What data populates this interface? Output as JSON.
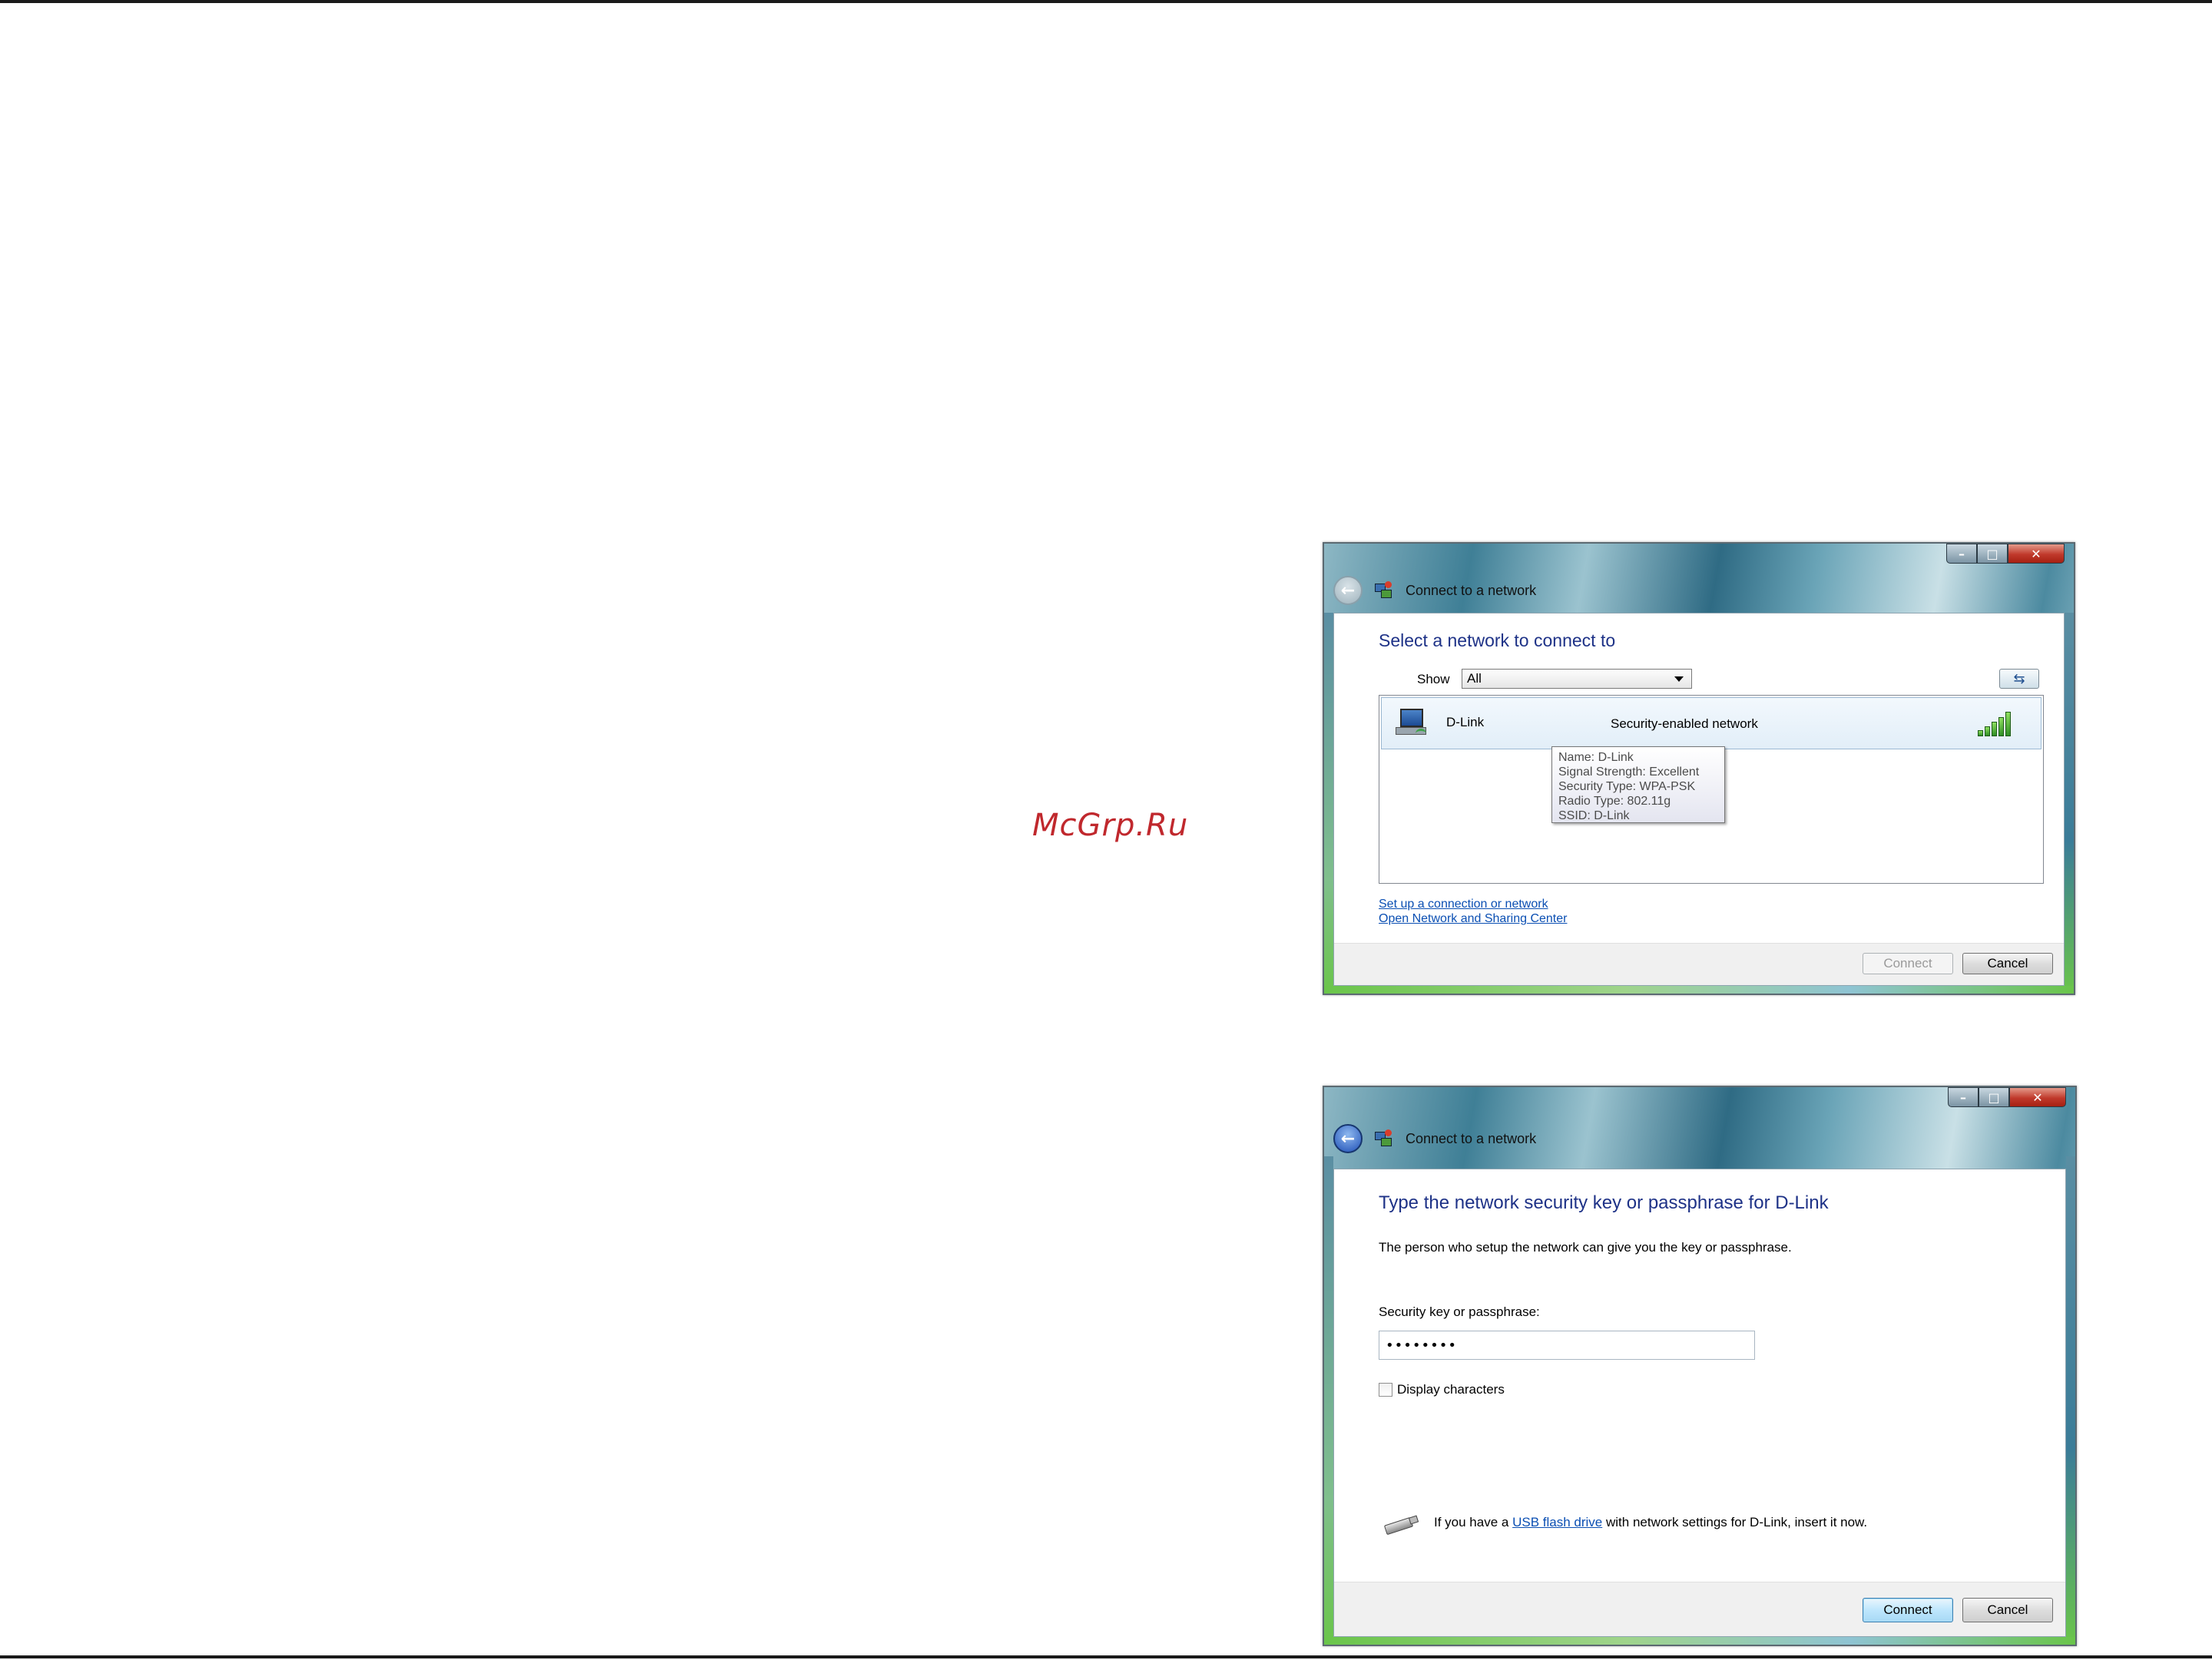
{
  "page": {
    "watermark": "McGrp.Ru"
  },
  "window1": {
    "title": "Connect to a network",
    "heading": "Select a network to connect to",
    "show_label": "Show",
    "show_value": "All",
    "network": {
      "name": "D-Link",
      "security": "Security-enabled network",
      "signal_bars": 5
    },
    "tooltip": {
      "lines": [
        "Name: D-Link",
        "Signal Strength: Excellent",
        "Security Type: WPA-PSK",
        "Radio Type: 802.11g",
        "SSID: D-Link"
      ]
    },
    "links": {
      "setup": "Set up a connection or network",
      "sharing": "Open Network and Sharing Center"
    },
    "buttons": {
      "connect": "Connect",
      "cancel": "Cancel"
    }
  },
  "window2": {
    "title": "Connect to a network",
    "heading": "Type the network security key or passphrase for D-Link",
    "description": "The person who setup the network can give you the key or passphrase.",
    "field_label": "Security key or passphrase:",
    "field_value": "••••••••",
    "checkbox_label": "Display characters",
    "usb_text_before": "If you have a",
    "usb_link": "USB flash drive",
    "usb_text_after": "with network settings for D-Link, insert it now.",
    "buttons": {
      "connect": "Connect",
      "cancel": "Cancel"
    }
  }
}
